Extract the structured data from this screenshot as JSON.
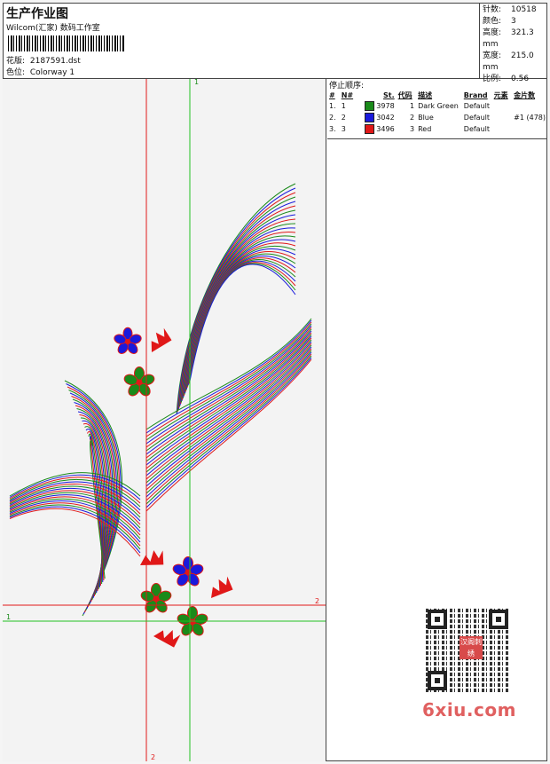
{
  "header": {
    "title": "生产作业图",
    "subtitle": "Wilcom(汇家) 数码工作室",
    "file_label": "花版:",
    "file_value": "2187591.dst",
    "colorway_label": "色位:",
    "colorway_value": "Colorway 1"
  },
  "stats": {
    "stitches_label": "针数:",
    "stitches_value": "10518",
    "colors_label": "颜色:",
    "colors_value": "3",
    "height_label": "高度:",
    "height_value": "321.3 mm",
    "width_label": "宽度:",
    "width_value": "215.0 mm",
    "scale_label": "比例:",
    "scale_value": "0.56"
  },
  "stop_sequence": {
    "title": "停止顺序:",
    "columns": [
      "#",
      "N#",
      "St.",
      "代码",
      "描述",
      "Brand",
      "元素",
      "金片数"
    ],
    "rows": [
      {
        "idx": "1.",
        "n": "1",
        "st": "3978",
        "code": "1",
        "desc": "Dark Green",
        "brand": "Default",
        "elem": "",
        "seq": "",
        "color": "#1a8a1a"
      },
      {
        "idx": "2.",
        "n": "2",
        "st": "3042",
        "code": "2",
        "desc": "Blue",
        "brand": "Default",
        "elem": "",
        "seq": "#1 (478)",
        "color": "#1a1adc"
      },
      {
        "idx": "3.",
        "n": "3",
        "st": "3496",
        "code": "3",
        "desc": "Red",
        "brand": "Default",
        "elem": "",
        "seq": "",
        "color": "#e01818"
      }
    ]
  },
  "guides": {
    "v1": "1",
    "v2": "2",
    "h1": "1",
    "h2": "2"
  },
  "watermark": {
    "brand_text": "6xiu.com",
    "stamp_text": "汉阁刺绣"
  },
  "colors": {
    "green": "#1a8a1a",
    "blue": "#1a1adc",
    "red": "#e01818",
    "guide_green": "#22c022",
    "guide_red": "#e01818"
  }
}
